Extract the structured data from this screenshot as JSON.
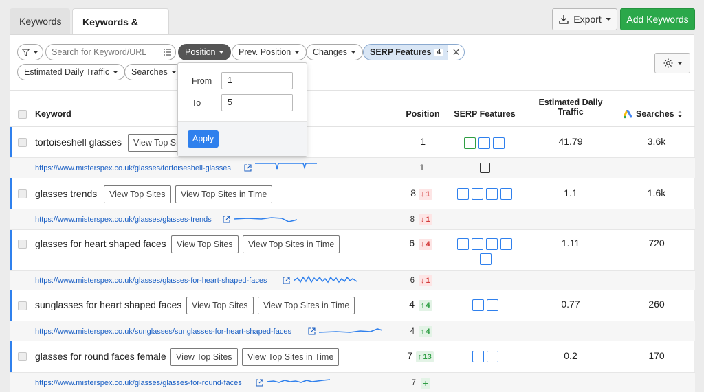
{
  "tabs": [
    {
      "label": "Keywords",
      "active": false
    },
    {
      "label": "Keywords & URLs",
      "active": true
    }
  ],
  "toolbar": {
    "export_label": "Export",
    "add_label": "Add Keywords"
  },
  "filters": {
    "search_placeholder": "Search for Keyword/URL",
    "position": "Position",
    "prev_position": "Prev. Position",
    "changes": "Changes",
    "serp_features": "SERP Features",
    "serp_count": "4",
    "est_traffic": "Estimated Daily Traffic",
    "searches": "Searches"
  },
  "position_dropdown": {
    "from_label": "From",
    "from_value": "1",
    "to_label": "To",
    "to_value": "5",
    "apply_label": "Apply"
  },
  "columns": {
    "keyword": "Keyword",
    "position": "Position",
    "serp": "SERP Features",
    "traffic_line1": "Estimated Daily",
    "traffic_line2": "Traffic",
    "searches": "Searches"
  },
  "row_buttons": {
    "view_top": "View Top Sites",
    "view_top_time": "View Top Sites in Time"
  },
  "rows": [
    {
      "keyword": "tortoiseshell glasses",
      "position": "1",
      "change": "",
      "dir": "",
      "traffic": "41.79",
      "searches": "3.6k",
      "url": "https://www.misterspex.co.uk/glasses/tortoiseshell-glasses",
      "url_pos": "1",
      "url_change": "",
      "url_dir": ""
    },
    {
      "keyword": "glasses trends",
      "position": "8",
      "change": "1",
      "dir": "down",
      "traffic": "1.1",
      "searches": "1.6k",
      "url": "https://www.misterspex.co.uk/glasses/glasses-trends",
      "url_pos": "8",
      "url_change": "1",
      "url_dir": "down"
    },
    {
      "keyword": "glasses for heart shaped faces",
      "position": "6",
      "change": "4",
      "dir": "down",
      "traffic": "1.11",
      "searches": "720",
      "url": "https://www.misterspex.co.uk/glasses/glasses-for-heart-shaped-faces",
      "url_pos": "6",
      "url_change": "1",
      "url_dir": "down"
    },
    {
      "keyword": "sunglasses for heart shaped faces",
      "position": "4",
      "change": "4",
      "dir": "up",
      "traffic": "0.77",
      "searches": "260",
      "url": "https://www.misterspex.co.uk/sunglasses/sunglasses-for-heart-shaped-faces",
      "url_pos": "4",
      "url_change": "4",
      "url_dir": "up"
    },
    {
      "keyword": "glasses for round faces female",
      "position": "7",
      "change": "13",
      "dir": "up",
      "traffic": "0.2",
      "searches": "170",
      "url": "https://www.misterspex.co.uk/glasses/glasses-for-round-faces",
      "url_pos": "7",
      "url_change": "",
      "url_dir": "new"
    }
  ],
  "colors": {
    "accent": "#2f80ed",
    "green": "#2ba84a",
    "down": "#d23c3c",
    "up": "#2f9e44"
  }
}
